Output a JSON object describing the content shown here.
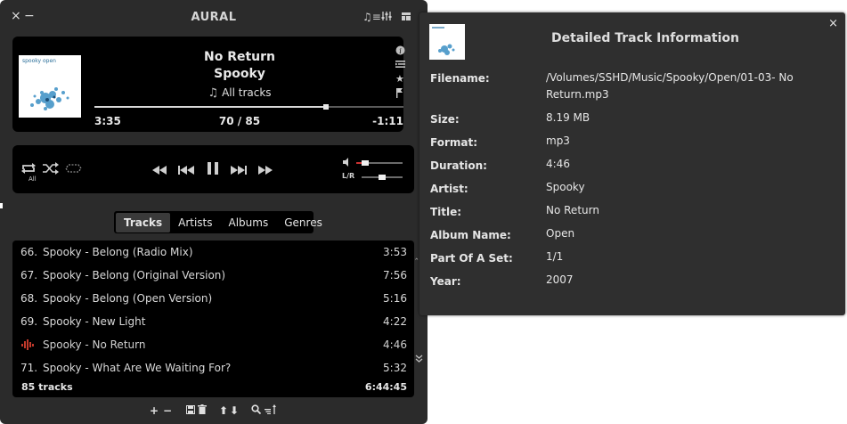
{
  "app": {
    "title": "AURAL",
    "close_icon": "×",
    "minimize_icon": "−"
  },
  "now_playing": {
    "title": "No Return",
    "artist": "Spooky",
    "playlist_label": "All tracks",
    "elapsed": "3:35",
    "position": "70 / 85",
    "remaining": "-1:11",
    "progress_fraction": 0.75,
    "album_art_text": "spooky open"
  },
  "controls": {
    "repeat_mode_label": "All",
    "volume_fraction": 0.2,
    "balance_fraction": 0.5,
    "lr_label": "L/R",
    "volume_color": "#cc3333"
  },
  "tabs": [
    "Tracks",
    "Artists",
    "Albums",
    "Genres"
  ],
  "active_tab": "Tracks",
  "tracks": [
    {
      "num": "66.",
      "name": "Spooky - Belong (Radio Mix)",
      "duration": "3:53"
    },
    {
      "num": "67.",
      "name": "Spooky - Belong (Original Version)",
      "duration": "7:56"
    },
    {
      "num": "68.",
      "name": "Spooky - Belong (Open Version)",
      "duration": "5:16"
    },
    {
      "num": "69.",
      "name": "Spooky - New Light",
      "duration": "4:22"
    },
    {
      "num": "",
      "name": "Spooky - No Return",
      "duration": "4:46",
      "playing": true
    },
    {
      "num": "71.",
      "name": "Spooky - What Are We Waiting For?",
      "duration": "5:32"
    }
  ],
  "tracklist_summary": {
    "count": "85 tracks",
    "total_duration": "6:44:45"
  },
  "playing_indicator_color": "#c0392b",
  "info_panel": {
    "title": "Detailed Track Information",
    "close_icon": "×",
    "fields": [
      {
        "label": "Filename:",
        "value": "/Volumes/SSHD/Music/Spooky/Open/01-03- No Return.mp3"
      },
      {
        "label": "Size:",
        "value": "8.19 MB"
      },
      {
        "label": "Format:",
        "value": "mp3"
      },
      {
        "label": "Duration:",
        "value": "4:46"
      },
      {
        "label": "Artist:",
        "value": "Spooky"
      },
      {
        "label": "Title:",
        "value": "No Return"
      },
      {
        "label": "Album Name:",
        "value": "Open"
      },
      {
        "label": "Part Of A Set:",
        "value": "1/1"
      },
      {
        "label": "Year:",
        "value": "2007"
      }
    ]
  }
}
